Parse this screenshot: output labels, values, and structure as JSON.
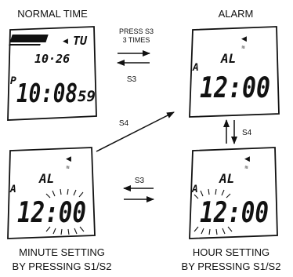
{
  "captions": {
    "normal_time": "NORMAL TIME",
    "alarm": "ALARM",
    "minute_setting_line1": "MINUTE SETTING",
    "minute_setting_line2": "BY PRESSING S1/S2",
    "hour_setting_line1": "HOUR SETTING",
    "hour_setting_line2": "BY PRESSING S1/S2"
  },
  "transitions": {
    "top_to_right_line1": "PRESS S3",
    "top_to_right_line2": "3 TIMES",
    "top_back": "S3",
    "diagonal": "S4",
    "vertical": "S4",
    "bottom": "S3"
  },
  "screens": {
    "normal": {
      "day": "TU",
      "date": "10·26",
      "pm": "P",
      "time": "10:08",
      "seconds": "59"
    },
    "alarm": {
      "mode": "AL",
      "ampm": "A",
      "time": "12:00"
    },
    "minute_setting": {
      "mode": "AL",
      "ampm": "A",
      "time": "12:00",
      "blinking": "minutes"
    },
    "hour_setting": {
      "mode": "AL",
      "ampm": "A",
      "time": "12:00",
      "blinking": "hours"
    }
  },
  "colors": {
    "ink": "#111111",
    "background": "#ffffff"
  }
}
